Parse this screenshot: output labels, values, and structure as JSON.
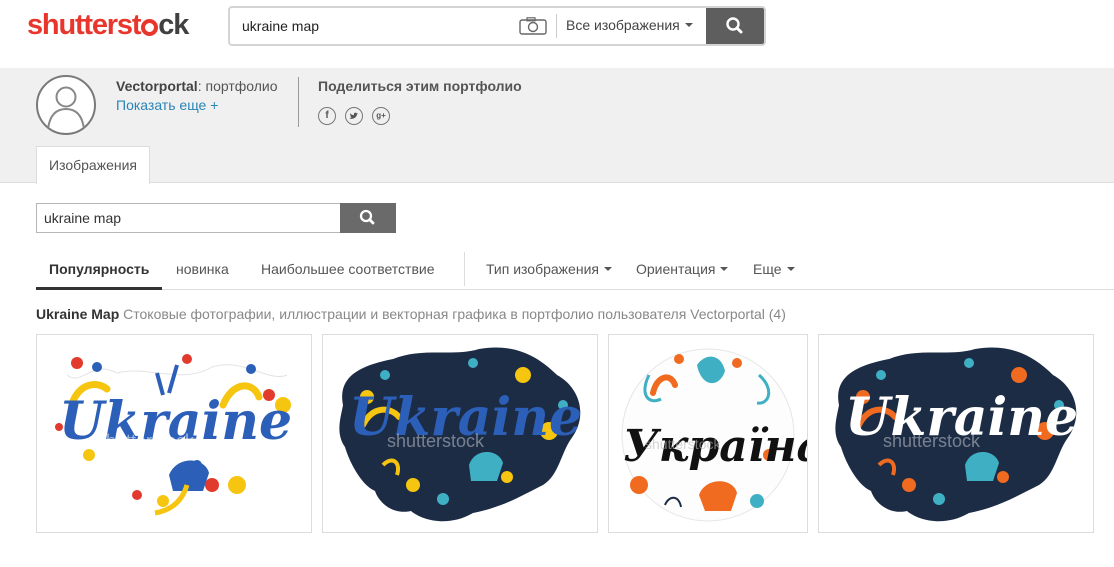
{
  "brand": {
    "logo_part1": "shutterst",
    "logo_part2": "ck",
    "accent": "#e8362c"
  },
  "header_search": {
    "query": "ukraine map",
    "scope": "Все изображения",
    "camera_icon": "camera-icon",
    "search_icon": "search-icon"
  },
  "portfolio": {
    "name": "Vectorportal",
    "name_suffix": ": портфолио",
    "show_more": "Показать еще +",
    "share_title": "Поделиться этим портфолио",
    "social": [
      "f",
      "t",
      "g+"
    ],
    "tab": "Изображения"
  },
  "portfolio_search": {
    "query": "ukraine map"
  },
  "sort": {
    "popular": "Популярность",
    "newest": "новинка",
    "relevance": "Наибольшее соответствие",
    "image_type": "Тип изображения",
    "orientation": "Ориентация",
    "more": "Еще"
  },
  "caption": {
    "title": "Ukraine Map",
    "text": " Стоковые фотографии, иллюстрации и векторная графика в портфолио пользователя Vectorportal (4)"
  },
  "thumbnails": [
    {
      "word": "Ukraine",
      "watermark": "shutterstock",
      "theme": "white"
    },
    {
      "word": "Ukraine",
      "watermark": "shutterstock",
      "theme": "navy-yellow"
    },
    {
      "word": "Україна",
      "watermark": "shutterstock",
      "theme": "circle"
    },
    {
      "word": "Ukraine",
      "watermark": "shutterstock",
      "theme": "navy-orange"
    }
  ],
  "colors": {
    "navy": "#1d2c45",
    "blue": "#2b5fb8",
    "yellow": "#f5c510",
    "orange": "#f06a20",
    "teal": "#3fb0c4",
    "link": "#2a84b8"
  }
}
